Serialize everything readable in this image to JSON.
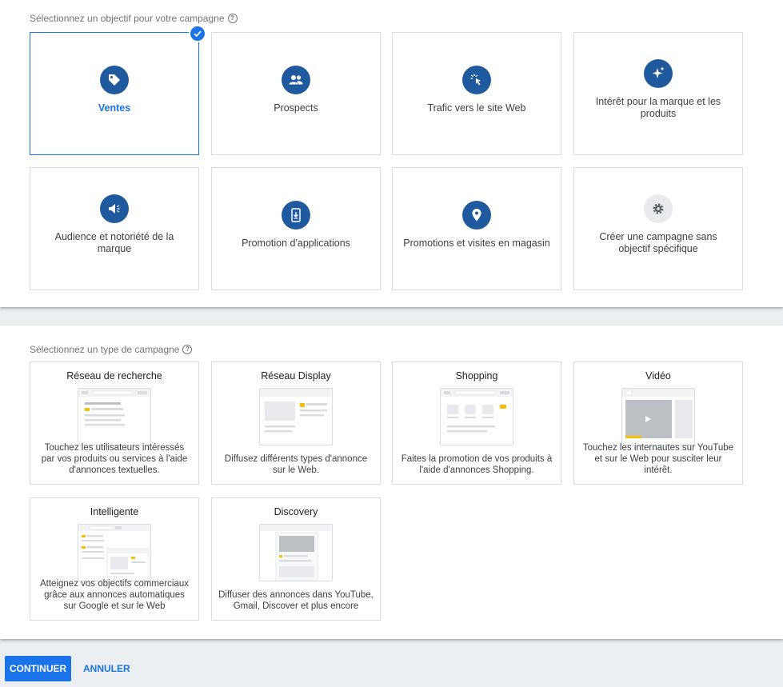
{
  "objectives": {
    "title": "Sélectionnez un objectif pour votre campagne",
    "help_icon": "?",
    "items": [
      {
        "label": "Ventes",
        "icon": "tag-icon",
        "selected": true
      },
      {
        "label": "Prospects",
        "icon": "people-icon"
      },
      {
        "label": "Trafic vers le site Web",
        "icon": "cursor-click-icon"
      },
      {
        "label": "Intérêt pour la marque et les produits",
        "icon": "sparkle-icon"
      },
      {
        "label": "Audience et notoriété de la marque",
        "icon": "megaphone-icon"
      },
      {
        "label": "Promotion d'applications",
        "icon": "phone-download-icon"
      },
      {
        "label": "Promotions et visites en magasin",
        "icon": "location-pin-icon"
      },
      {
        "label": "Créer une campagne sans objectif spécifique",
        "icon": "gear-icon"
      }
    ]
  },
  "campaign_types": {
    "title": "Sélectionnez un type de campagne",
    "help_icon": "?",
    "items": [
      {
        "title": "Réseau de recherche",
        "description": "Touchez les utilisateurs intéressés par vos produits ou services à l'aide d'annonces textuelles."
      },
      {
        "title": "Réseau Display",
        "description": "Diffusez différents types d'annonce sur le Web."
      },
      {
        "title": "Shopping",
        "description": "Faites la promotion de vos produits à l'aide d'annonces Shopping."
      },
      {
        "title": "Vidéo",
        "description": "Touchez les internautes sur YouTube et sur le Web pour susciter leur intérêt."
      },
      {
        "title": "Intelligente",
        "description": "Atteignez vos objectifs commerciaux grâce aux annonces automatiques sur Google et sur le Web"
      },
      {
        "title": "Discovery",
        "description": "Diffuser des annonces dans YouTube, Gmail, Discover et plus encore"
      }
    ]
  },
  "actions": {
    "continue_label": "CONTINUER",
    "cancel_label": "ANNULER"
  },
  "colors": {
    "accent": "#1a73e8",
    "icon_bg": "#1f5a9e",
    "illustration_highlight": "#fbbc04"
  }
}
